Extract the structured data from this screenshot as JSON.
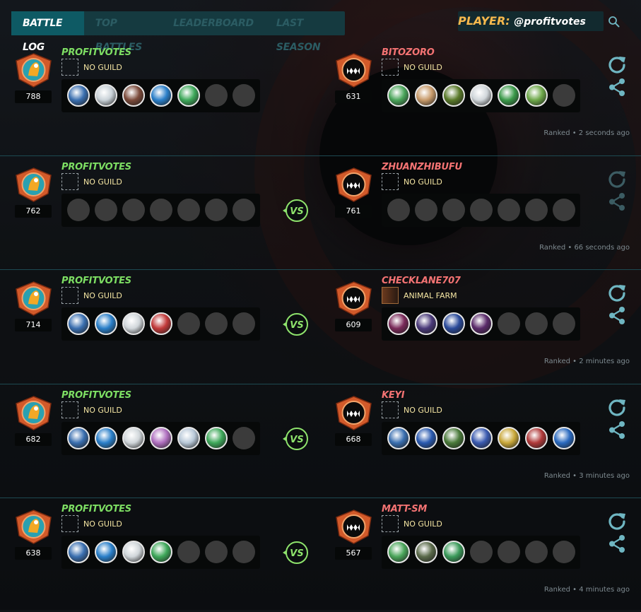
{
  "header": {
    "tabs": [
      "BATTLE LOG",
      "TOP BATTLES",
      "LEADERBOARD",
      "LAST SEASON"
    ],
    "active_tab": 0,
    "player_label": "PLAYER:",
    "player_value": "@profitvotes",
    "search_icon": "search-icon"
  },
  "colors": {
    "accent": "#0e5a64",
    "player_label": "#f6b84d",
    "winner_name": "#7dde63",
    "loser_name": "#f47373",
    "guild_text": "#f5e6a3",
    "vs_badge": "#8ee36c",
    "action_icon": "#6fb6c2"
  },
  "battles": [
    {
      "left": {
        "name": "PROFITVOTES",
        "guild": "NO GUILD",
        "rating": "788",
        "cards": [
          "#3a6fb0",
          "#c9d2d8",
          "#7b4a3a",
          "#2a7fc9",
          "#3ea85a",
          "",
          ""
        ]
      },
      "right": {
        "name": "BITOZORO",
        "guild": "NO GUILD",
        "rating": "631",
        "cards": [
          "#4aa55a",
          "#c79a6a",
          "#5a7a2a",
          "#d0d6da",
          "#3b9a4a",
          "#6ea84a",
          ""
        ]
      },
      "vs": false,
      "result": "Ranked • 2 seconds ago",
      "actions_dim": false
    },
    {
      "left": {
        "name": "PROFITVOTES",
        "guild": "NO GUILD",
        "rating": "762",
        "cards": [
          "",
          "",
          "",
          "",
          "",
          "",
          ""
        ]
      },
      "right": {
        "name": "ZHUANZHIBUFU",
        "guild": "NO GUILD",
        "rating": "761",
        "cards": [
          "",
          "",
          "",
          "",
          "",
          "",
          ""
        ]
      },
      "vs": true,
      "vs_label": "VS",
      "result": "Ranked • 66 seconds ago",
      "actions_dim": true
    },
    {
      "left": {
        "name": "PROFITVOTES",
        "guild": "NO GUILD",
        "rating": "714",
        "cards": [
          "#3a6fb0",
          "#2a7fc9",
          "#d0d6da",
          "#c23a3a",
          "",
          "",
          ""
        ]
      },
      "right": {
        "name": "CHECKLANE707",
        "guild": "ANIMAL FARM",
        "rating": "609",
        "cards": [
          "#7a2a5a",
          "#4a3a7a",
          "#2a4a9a",
          "#5a2a6a",
          "",
          "",
          ""
        ]
      },
      "vs": true,
      "vs_label": "VS",
      "result": "Ranked • 2 minutes ago",
      "actions_dim": false
    },
    {
      "left": {
        "name": "PROFITVOTES",
        "guild": "NO GUILD",
        "rating": "682",
        "cards": [
          "#3a6fb0",
          "#2a7fc9",
          "#d0d6da",
          "#b070c0",
          "#b8c8d8",
          "#3ea85a",
          ""
        ]
      },
      "right": {
        "name": "KEYI",
        "guild": "NO GUILD",
        "rating": "668",
        "cards": [
          "#3a6fb0",
          "#2a5ab0",
          "#4a7a3a",
          "#3a5ab0",
          "#c9a83a",
          "#b03a3a",
          "#2a6ac0"
        ]
      },
      "vs": true,
      "vs_label": "VS",
      "result": "Ranked • 3 minutes ago",
      "actions_dim": false
    },
    {
      "left": {
        "name": "PROFITVOTES",
        "guild": "NO GUILD",
        "rating": "638",
        "cards": [
          "#3a6fb0",
          "#2a7fc9",
          "#d0d6da",
          "#3ea85a",
          "",
          "",
          ""
        ]
      },
      "right": {
        "name": "MATT-SM",
        "guild": "NO GUILD",
        "rating": "567",
        "cards": [
          "#4aa55a",
          "#5a6a4a",
          "#3a9a5a",
          "",
          "",
          "",
          ""
        ]
      },
      "vs": true,
      "vs_label": "VS",
      "result": "Ranked • 4 minutes ago",
      "actions_dim": false
    }
  ]
}
